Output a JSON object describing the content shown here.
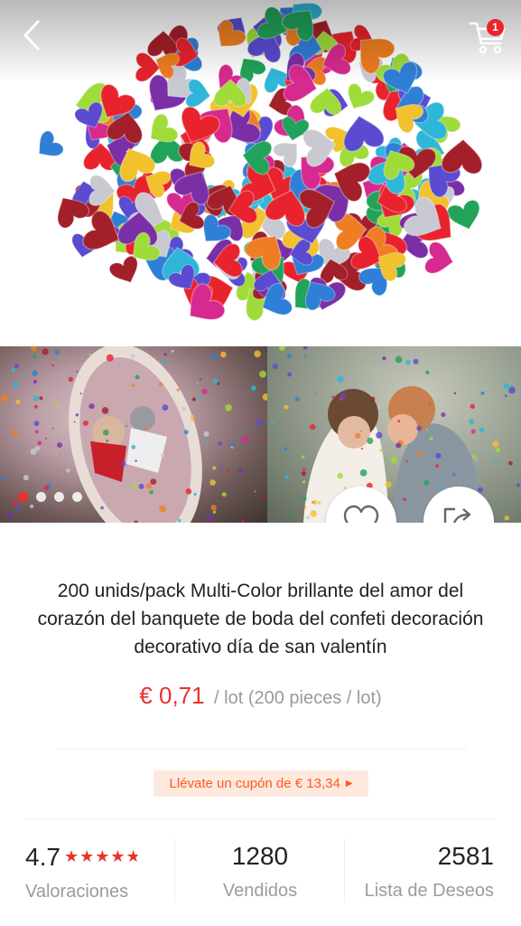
{
  "header": {
    "cart_count": "1"
  },
  "gallery": {
    "dots_total": 4,
    "active_dot": 0
  },
  "product": {
    "title": "200 unids/pack Multi-Color brillante del amor del corazón del banquete de boda del confeti decoración decorativo día de san valentín",
    "price": "€ 0,71",
    "unit": "/ lot (200 pieces / lot)"
  },
  "coupon": {
    "label": "Llévate un cupón de € 13,34"
  },
  "stats": {
    "rating_value": "4.7",
    "rating_label": "Valoraciones",
    "sold_value": "1280",
    "sold_label": "Vendidos",
    "wishlist_value": "2581",
    "wishlist_label": "Lista de Deseos"
  },
  "colors": {
    "accent": "#e8332a",
    "coupon_bg": "#fde9de",
    "coupon_text": "#ff5a1f",
    "muted_text": "#9b9b9b"
  },
  "icons": [
    "back-arrow-icon",
    "cart-icon",
    "heart-icon",
    "share-icon",
    "star-icon",
    "caret-right-icon"
  ]
}
